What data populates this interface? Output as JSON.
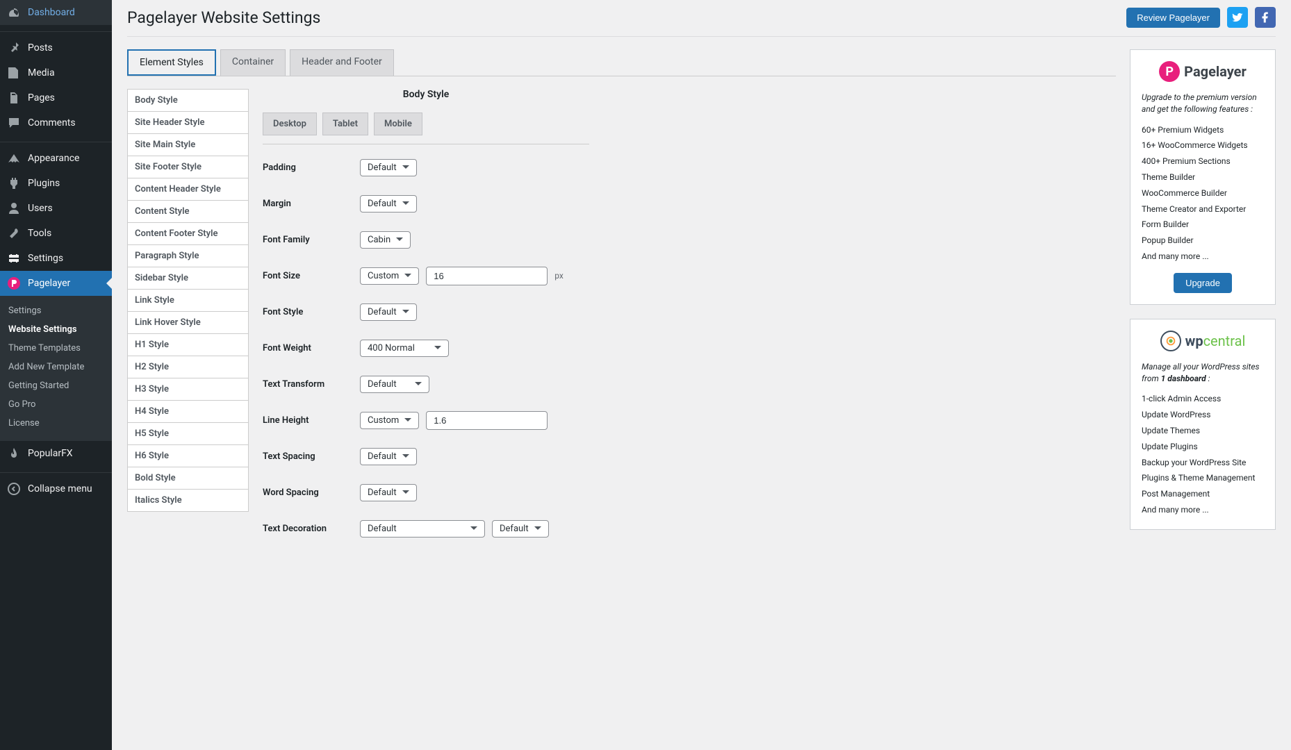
{
  "sidebar": {
    "items": [
      {
        "label": "Dashboard"
      },
      {
        "label": "Posts"
      },
      {
        "label": "Media"
      },
      {
        "label": "Pages"
      },
      {
        "label": "Comments"
      },
      {
        "label": "Appearance"
      },
      {
        "label": "Plugins"
      },
      {
        "label": "Users"
      },
      {
        "label": "Tools"
      },
      {
        "label": "Settings"
      },
      {
        "label": "Pagelayer"
      },
      {
        "label": "PopularFX"
      },
      {
        "label": "Collapse menu"
      }
    ],
    "submenu": [
      {
        "label": "Settings"
      },
      {
        "label": "Website Settings"
      },
      {
        "label": "Theme Templates"
      },
      {
        "label": "Add New Template"
      },
      {
        "label": "Getting Started"
      },
      {
        "label": "Go Pro"
      },
      {
        "label": "License"
      }
    ]
  },
  "header": {
    "title": "Pagelayer Website Settings",
    "review_btn": "Review Pagelayer"
  },
  "nav_tabs": [
    "Element Styles",
    "Container",
    "Header and Footer"
  ],
  "style_list": [
    "Body Style",
    "Site Header Style",
    "Site Main Style",
    "Site Footer Style",
    "Content Header Style",
    "Content Style",
    "Content Footer Style",
    "Paragraph Style",
    "Sidebar Style",
    "Link Style",
    "Link Hover Style",
    "H1 Style",
    "H2 Style",
    "H3 Style",
    "H4 Style",
    "H5 Style",
    "H6 Style",
    "Bold Style",
    "Italics Style"
  ],
  "panel": {
    "title": "Body Style",
    "device_tabs": [
      "Desktop",
      "Tablet",
      "Mobile"
    ],
    "rows": {
      "padding": {
        "label": "Padding",
        "value": "Default"
      },
      "margin": {
        "label": "Margin",
        "value": "Default"
      },
      "font_family": {
        "label": "Font Family",
        "value": "Cabin"
      },
      "font_size": {
        "label": "Font Size",
        "sel": "Custom",
        "input": "16",
        "unit": "px"
      },
      "font_style": {
        "label": "Font Style",
        "value": "Default"
      },
      "font_weight": {
        "label": "Font Weight",
        "value": "400 Normal"
      },
      "text_transform": {
        "label": "Text Transform",
        "value": "Default"
      },
      "line_height": {
        "label": "Line Height",
        "sel": "Custom",
        "input": "1.6"
      },
      "text_spacing": {
        "label": "Text Spacing",
        "value": "Default"
      },
      "word_spacing": {
        "label": "Word Spacing",
        "value": "Default"
      },
      "text_decoration": {
        "label": "Text Decoration",
        "v1": "Default",
        "v2": "Default"
      }
    }
  },
  "promo1": {
    "logo": "Pagelayer",
    "text": "Upgrade to the premium version and get the following features :",
    "features": [
      "60+ Premium Widgets",
      "16+ WooCommerce Widgets",
      "400+ Premium Sections",
      "Theme Builder",
      "WooCommerce Builder",
      "Theme Creator and Exporter",
      "Form Builder",
      "Popup Builder",
      "And many more ..."
    ],
    "btn": "Upgrade"
  },
  "promo2": {
    "logo_pre": "wp",
    "logo_post": "central",
    "text_pre": "Manage all your WordPress sites from ",
    "text_bold": "1 dashboard",
    "text_post": " :",
    "features": [
      "1-click Admin Access",
      "Update WordPress",
      "Update Themes",
      "Update Plugins",
      "Backup your WordPress Site",
      "Plugins & Theme Management",
      "Post Management",
      "And many more ..."
    ]
  }
}
